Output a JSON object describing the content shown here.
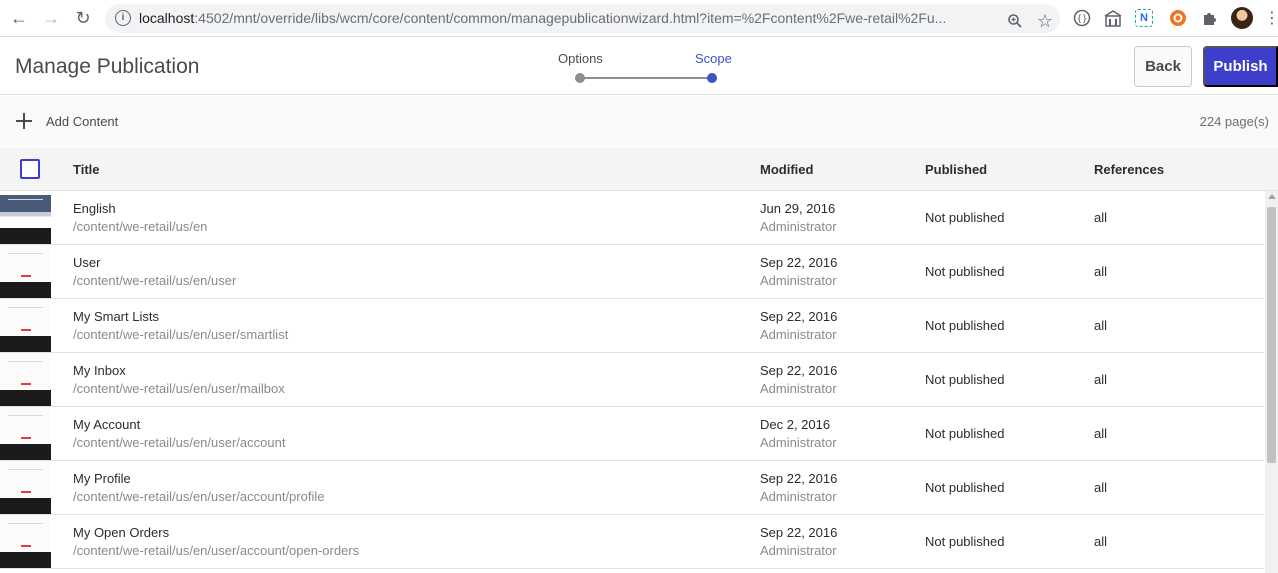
{
  "browser": {
    "url_host": "localhost",
    "url_rest": ":4502/mnt/override/libs/wcm/core/content/common/managepublicationwizard.html?item=%2Fcontent%2Fwe-retail%2Fu..."
  },
  "header": {
    "title": "Manage Publication",
    "steps": [
      {
        "label": "Options",
        "state": "complete"
      },
      {
        "label": "Scope",
        "state": "active"
      }
    ],
    "back_label": "Back",
    "publish_label": "Publish",
    "accent_color": "#3d3ec9"
  },
  "toolbar": {
    "add_content_label": "Add Content",
    "page_count": "224 page(s)"
  },
  "table": {
    "columns": [
      "Title",
      "Modified",
      "Published",
      "References"
    ],
    "rows": [
      {
        "title": "English",
        "path": "/content/we-retail/us/en",
        "date": "Jun 29, 2016",
        "by": "Administrator",
        "published": "Not published",
        "references": "all"
      },
      {
        "title": "User",
        "path": "/content/we-retail/us/en/user",
        "date": "Sep 22, 2016",
        "by": "Administrator",
        "published": "Not published",
        "references": "all"
      },
      {
        "title": "My Smart Lists",
        "path": "/content/we-retail/us/en/user/smartlist",
        "date": "Sep 22, 2016",
        "by": "Administrator",
        "published": "Not published",
        "references": "all"
      },
      {
        "title": "My Inbox",
        "path": "/content/we-retail/us/en/user/mailbox",
        "date": "Sep 22, 2016",
        "by": "Administrator",
        "published": "Not published",
        "references": "all"
      },
      {
        "title": "My Account",
        "path": "/content/we-retail/us/en/user/account",
        "date": "Dec 2, 2016",
        "by": "Administrator",
        "published": "Not published",
        "references": "all"
      },
      {
        "title": "My Profile",
        "path": "/content/we-retail/us/en/user/account/profile",
        "date": "Sep 22, 2016",
        "by": "Administrator",
        "published": "Not published",
        "references": "all"
      },
      {
        "title": "My Open Orders",
        "path": "/content/we-retail/us/en/user/account/open-orders",
        "date": "Sep 22, 2016",
        "by": "Administrator",
        "published": "Not published",
        "references": "all"
      }
    ]
  }
}
